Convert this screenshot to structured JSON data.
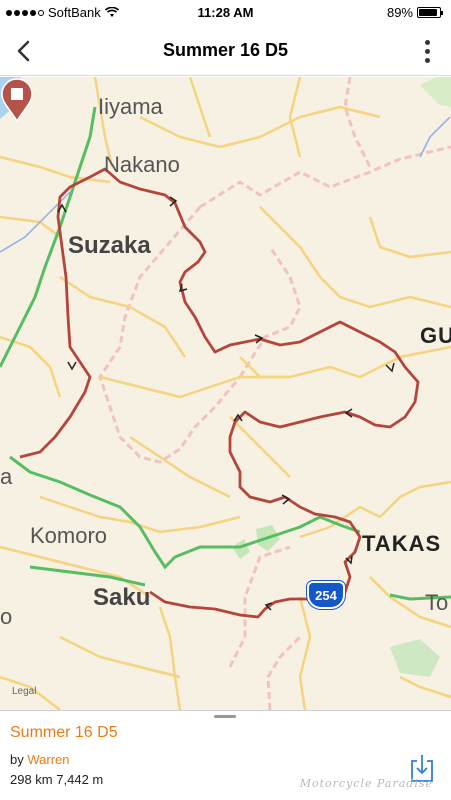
{
  "status_bar": {
    "carrier": "SoftBank",
    "time": "11:28 AM",
    "battery": "89%",
    "battery_level": 0.89
  },
  "nav": {
    "title": "Summer 16 D5",
    "back_icon": "chevron-left-icon",
    "more_icon": "more-vertical-icon"
  },
  "map": {
    "labels": {
      "iiyama": "Iiyama",
      "nakano": "Nakano",
      "suzaka": "Suzaka",
      "komoro": "Komoro",
      "saku": "Saku",
      "takas": "TAKAS",
      "gu": "GU",
      "a": "a",
      "o": "o",
      "to": "To"
    },
    "route_number": "254",
    "legal": "Legal",
    "route_color": "#b5443a",
    "start_marker_color": "#5aa85a",
    "end_marker_color": "#b5524a"
  },
  "route": {
    "name": "Summer 16 D5",
    "by_label": "by",
    "author": "Warren",
    "distance": "298 km",
    "elevation": "7,442 m"
  },
  "watermark": "Motorcycle Paradise",
  "accent_color": "#f07a12"
}
